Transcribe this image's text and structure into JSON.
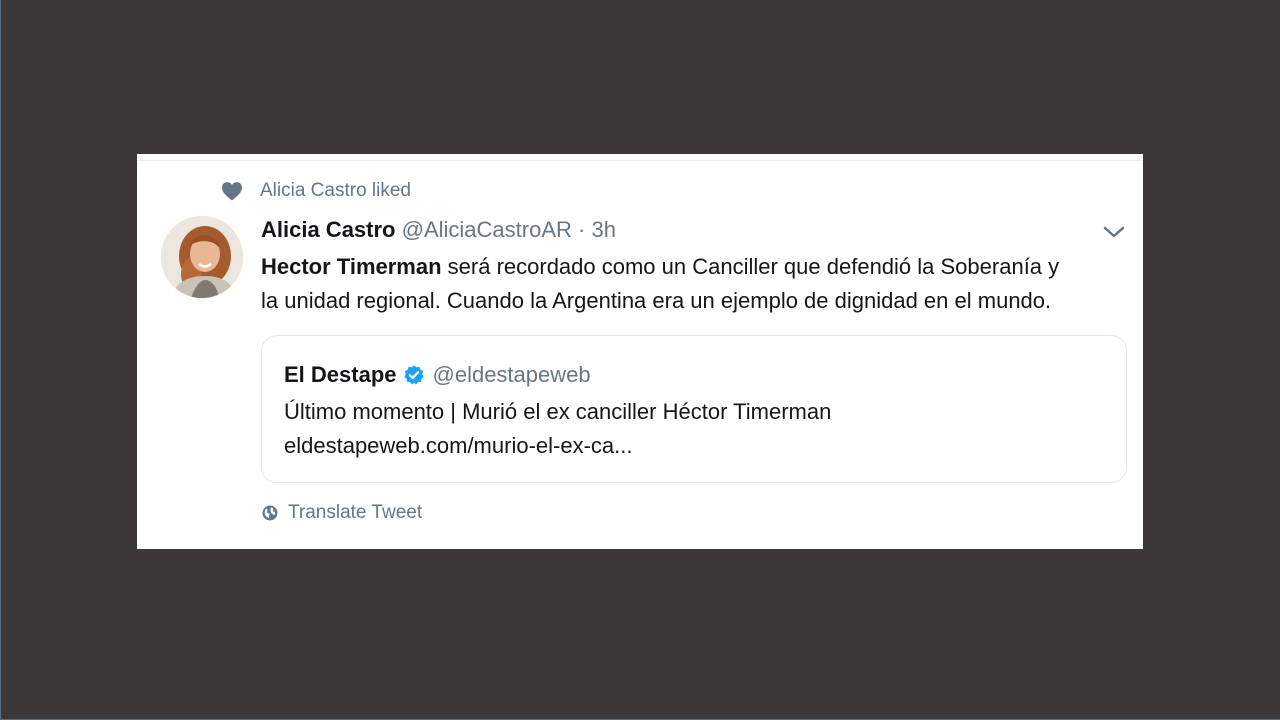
{
  "social_context": {
    "icon": "heart-icon",
    "text": "Alicia Castro liked"
  },
  "tweet": {
    "author_name": "Alicia Castro",
    "author_handle": "@AliciaCastroAR",
    "separator": "·",
    "timestamp": "3h",
    "text_bold": "Hector Timerman",
    "text_line1_rest": " será recordado como un Canciller que defendió la Soberanía y",
    "text_line2": "la unidad regional. Cuando la Argentina era un ejemplo de dignidad en el mundo.",
    "menu_icon": "chevron-down-icon"
  },
  "quoted_tweet": {
    "name": "El Destape",
    "verified": true,
    "handle": "@eldestapeweb",
    "line1": "Último momento | Murió el ex canciller Héctor Timerman",
    "line2": "eldestapeweb.com/murio-el-ex-ca..."
  },
  "translate": {
    "icon": "globe-icon",
    "label": "Translate Tweet"
  },
  "colors": {
    "background": "#3b3837",
    "card": "#ffffff",
    "secondary_text": "#657786",
    "primary_text": "#14171a",
    "verified_blue": "#1da1f2",
    "border": "#e1e8ed"
  }
}
